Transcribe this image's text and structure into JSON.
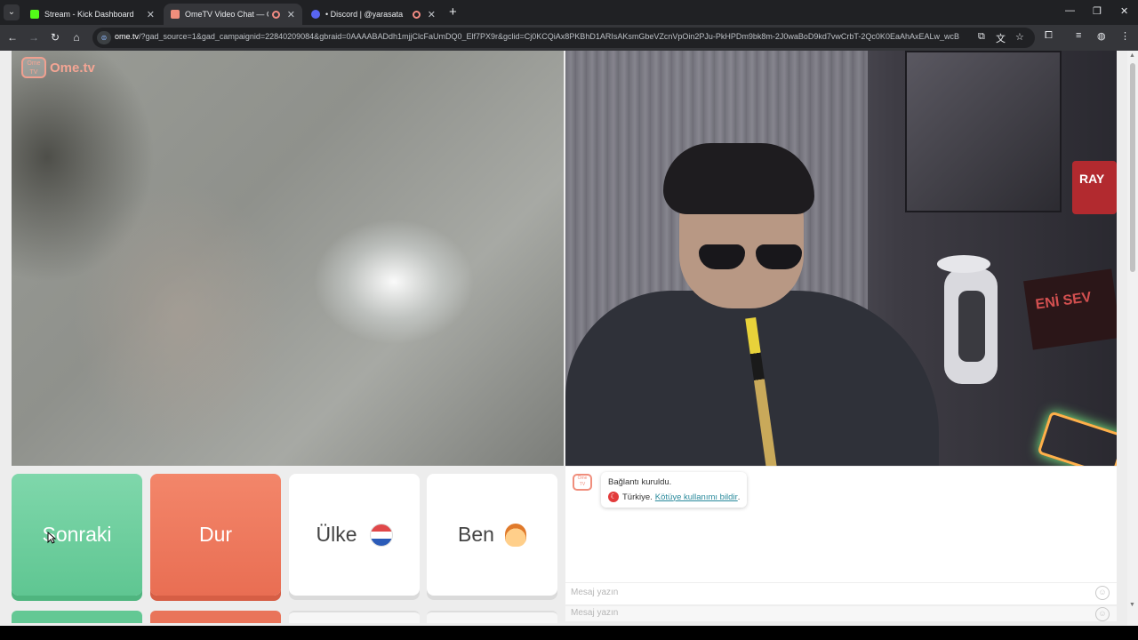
{
  "browser": {
    "tabs": [
      {
        "title": "Stream - Kick Dashboard",
        "favicon_color": "#53fc18",
        "active": false
      },
      {
        "title": "OmeTV Video Chat — Ome",
        "favicon_color": "#f08e7c",
        "active": true,
        "recording": true
      },
      {
        "title": "• Discord | @yarasata",
        "favicon_color": "#5865f2",
        "active": false,
        "recording": true
      }
    ],
    "tab_menu_icon": "chevron-down-icon",
    "new_tab_label": "+",
    "url_host": "ome.tv",
    "url_rest": "/?gad_source=1&gad_campaignid=22840209084&gbraid=0AAAABADdh1mjjClcFaUmDQ0_Elf7PX9r&gclid=Cj0KCQiAx8PKBhD1ARIsAKsmGbeVZcnVpOin2PJu-PkHPDm9bk8m-2J0waBoD9kd7vwCrbT-2Qc0K0EaAhAxEALw_wcB"
  },
  "app": {
    "logo_badge": "Ome TV",
    "logo_text": "Ome.tv"
  },
  "remote_video": {
    "sign_text": "RAY",
    "banner_text": "ENİ SEV"
  },
  "buttons": {
    "next_label": "Sonraki",
    "stop_label": "Dur",
    "country_label": "Ülke",
    "me_label": "Ben"
  },
  "chat": {
    "avatar_label": "Ome TV",
    "messages": [
      {
        "text": "Bağlantı kuruldu."
      },
      {
        "country": "Türkiye.",
        "report_link": "Kötüye kullanımı bildir"
      }
    ],
    "input_placeholder": "Mesaj yazın",
    "input_placeholder_ghost": "Mesaj yazın"
  },
  "colors": {
    "next_button": "#6fcf9e",
    "stop_button": "#ee7a5e",
    "accent": "#f08e7c",
    "link": "#2a8a9c"
  }
}
